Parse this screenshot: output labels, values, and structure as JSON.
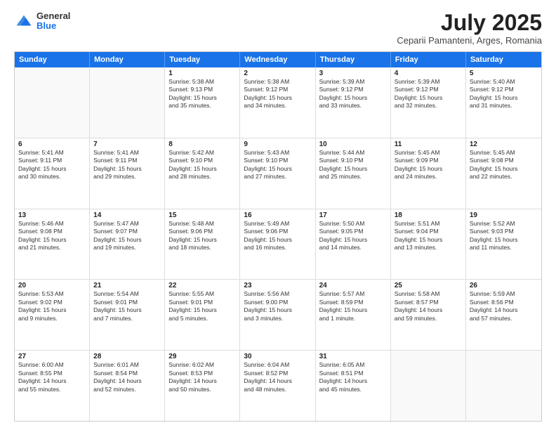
{
  "header": {
    "logo_general": "General",
    "logo_blue": "Blue",
    "title": "July 2025",
    "subtitle": "Ceparii Pamanteni, Arges, Romania"
  },
  "weekdays": [
    "Sunday",
    "Monday",
    "Tuesday",
    "Wednesday",
    "Thursday",
    "Friday",
    "Saturday"
  ],
  "rows": [
    [
      {
        "day": "",
        "text": ""
      },
      {
        "day": "",
        "text": ""
      },
      {
        "day": "1",
        "text": "Sunrise: 5:38 AM\nSunset: 9:13 PM\nDaylight: 15 hours\nand 35 minutes."
      },
      {
        "day": "2",
        "text": "Sunrise: 5:38 AM\nSunset: 9:12 PM\nDaylight: 15 hours\nand 34 minutes."
      },
      {
        "day": "3",
        "text": "Sunrise: 5:39 AM\nSunset: 9:12 PM\nDaylight: 15 hours\nand 33 minutes."
      },
      {
        "day": "4",
        "text": "Sunrise: 5:39 AM\nSunset: 9:12 PM\nDaylight: 15 hours\nand 32 minutes."
      },
      {
        "day": "5",
        "text": "Sunrise: 5:40 AM\nSunset: 9:12 PM\nDaylight: 15 hours\nand 31 minutes."
      }
    ],
    [
      {
        "day": "6",
        "text": "Sunrise: 5:41 AM\nSunset: 9:11 PM\nDaylight: 15 hours\nand 30 minutes."
      },
      {
        "day": "7",
        "text": "Sunrise: 5:41 AM\nSunset: 9:11 PM\nDaylight: 15 hours\nand 29 minutes."
      },
      {
        "day": "8",
        "text": "Sunrise: 5:42 AM\nSunset: 9:10 PM\nDaylight: 15 hours\nand 28 minutes."
      },
      {
        "day": "9",
        "text": "Sunrise: 5:43 AM\nSunset: 9:10 PM\nDaylight: 15 hours\nand 27 minutes."
      },
      {
        "day": "10",
        "text": "Sunrise: 5:44 AM\nSunset: 9:10 PM\nDaylight: 15 hours\nand 25 minutes."
      },
      {
        "day": "11",
        "text": "Sunrise: 5:45 AM\nSunset: 9:09 PM\nDaylight: 15 hours\nand 24 minutes."
      },
      {
        "day": "12",
        "text": "Sunrise: 5:45 AM\nSunset: 9:08 PM\nDaylight: 15 hours\nand 22 minutes."
      }
    ],
    [
      {
        "day": "13",
        "text": "Sunrise: 5:46 AM\nSunset: 9:08 PM\nDaylight: 15 hours\nand 21 minutes."
      },
      {
        "day": "14",
        "text": "Sunrise: 5:47 AM\nSunset: 9:07 PM\nDaylight: 15 hours\nand 19 minutes."
      },
      {
        "day": "15",
        "text": "Sunrise: 5:48 AM\nSunset: 9:06 PM\nDaylight: 15 hours\nand 18 minutes."
      },
      {
        "day": "16",
        "text": "Sunrise: 5:49 AM\nSunset: 9:06 PM\nDaylight: 15 hours\nand 16 minutes."
      },
      {
        "day": "17",
        "text": "Sunrise: 5:50 AM\nSunset: 9:05 PM\nDaylight: 15 hours\nand 14 minutes."
      },
      {
        "day": "18",
        "text": "Sunrise: 5:51 AM\nSunset: 9:04 PM\nDaylight: 15 hours\nand 13 minutes."
      },
      {
        "day": "19",
        "text": "Sunrise: 5:52 AM\nSunset: 9:03 PM\nDaylight: 15 hours\nand 11 minutes."
      }
    ],
    [
      {
        "day": "20",
        "text": "Sunrise: 5:53 AM\nSunset: 9:02 PM\nDaylight: 15 hours\nand 9 minutes."
      },
      {
        "day": "21",
        "text": "Sunrise: 5:54 AM\nSunset: 9:01 PM\nDaylight: 15 hours\nand 7 minutes."
      },
      {
        "day": "22",
        "text": "Sunrise: 5:55 AM\nSunset: 9:01 PM\nDaylight: 15 hours\nand 5 minutes."
      },
      {
        "day": "23",
        "text": "Sunrise: 5:56 AM\nSunset: 9:00 PM\nDaylight: 15 hours\nand 3 minutes."
      },
      {
        "day": "24",
        "text": "Sunrise: 5:57 AM\nSunset: 8:59 PM\nDaylight: 15 hours\nand 1 minute."
      },
      {
        "day": "25",
        "text": "Sunrise: 5:58 AM\nSunset: 8:57 PM\nDaylight: 14 hours\nand 59 minutes."
      },
      {
        "day": "26",
        "text": "Sunrise: 5:59 AM\nSunset: 8:56 PM\nDaylight: 14 hours\nand 57 minutes."
      }
    ],
    [
      {
        "day": "27",
        "text": "Sunrise: 6:00 AM\nSunset: 8:55 PM\nDaylight: 14 hours\nand 55 minutes."
      },
      {
        "day": "28",
        "text": "Sunrise: 6:01 AM\nSunset: 8:54 PM\nDaylight: 14 hours\nand 52 minutes."
      },
      {
        "day": "29",
        "text": "Sunrise: 6:02 AM\nSunset: 8:53 PM\nDaylight: 14 hours\nand 50 minutes."
      },
      {
        "day": "30",
        "text": "Sunrise: 6:04 AM\nSunset: 8:52 PM\nDaylight: 14 hours\nand 48 minutes."
      },
      {
        "day": "31",
        "text": "Sunrise: 6:05 AM\nSunset: 8:51 PM\nDaylight: 14 hours\nand 45 minutes."
      },
      {
        "day": "",
        "text": ""
      },
      {
        "day": "",
        "text": ""
      }
    ]
  ]
}
